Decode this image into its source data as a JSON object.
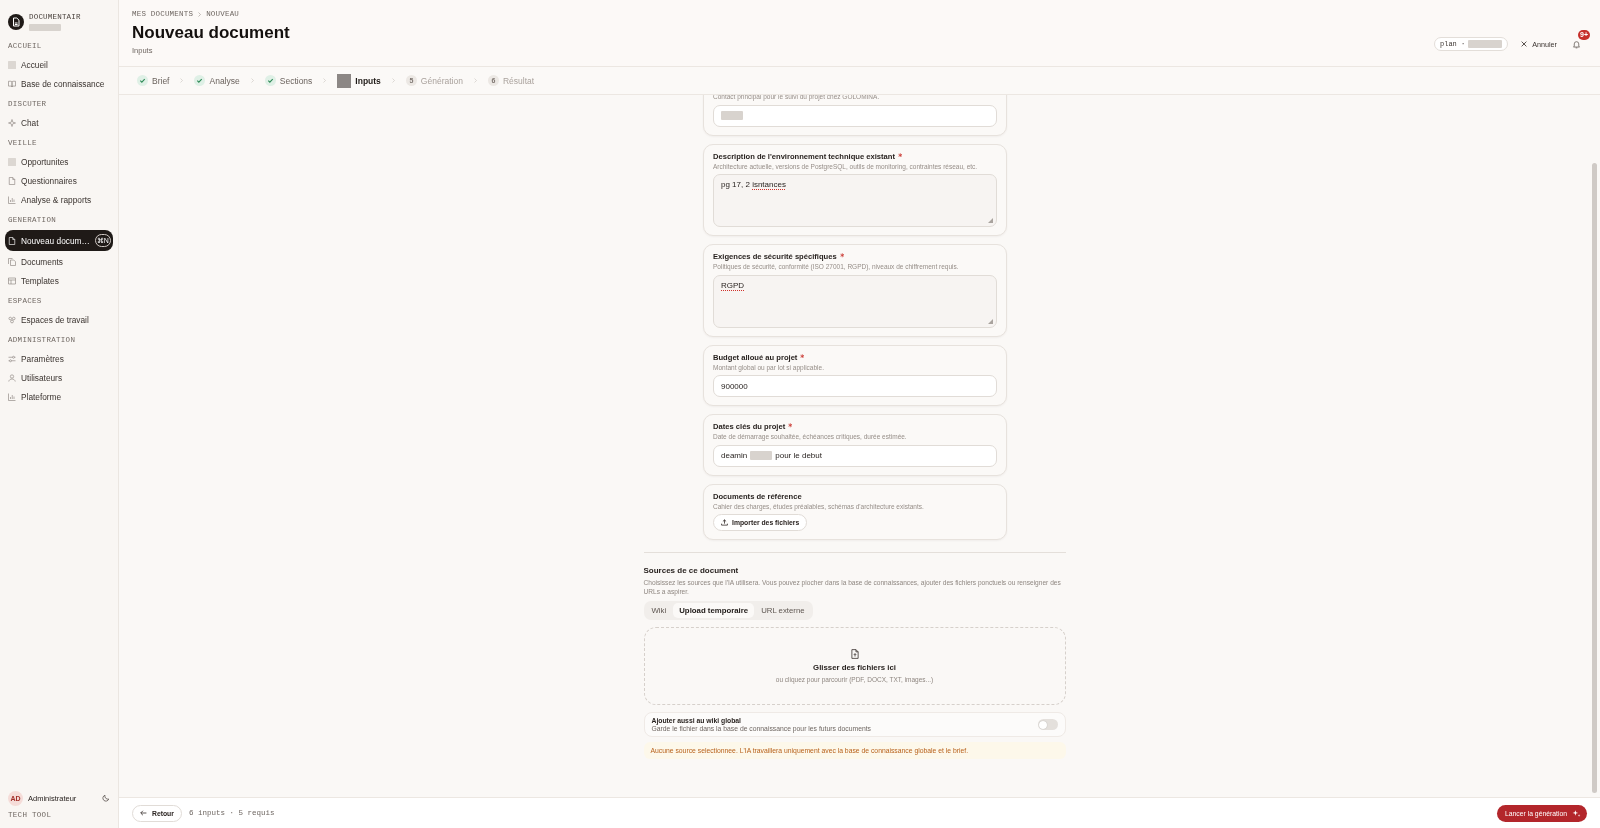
{
  "sidebar": {
    "brand": "DOCUMENTAIR",
    "sections": [
      {
        "label": "ACCUEIL",
        "items": [
          {
            "label": "Accueil",
            "selected": false
          },
          {
            "label": "Base de connaissance",
            "selected": false
          }
        ]
      },
      {
        "label": "DISCUTER",
        "items": [
          {
            "label": "Chat",
            "selected": false
          }
        ]
      },
      {
        "label": "VEILLE",
        "items": [
          {
            "label": "Opportunites",
            "selected": false
          },
          {
            "label": "Questionnaires",
            "selected": false
          },
          {
            "label": "Analyse & rapports",
            "selected": false
          }
        ]
      },
      {
        "label": "GENERATION",
        "items": [
          {
            "label": "Nouveau docum…",
            "selected": true,
            "shortcut": "⌘N"
          },
          {
            "label": "Documents",
            "selected": false
          },
          {
            "label": "Templates",
            "selected": false
          }
        ]
      },
      {
        "label": "ESPACES",
        "items": [
          {
            "label": "Espaces de travail",
            "selected": false
          }
        ]
      },
      {
        "label": "ADMINISTRATION",
        "items": [
          {
            "label": "Paramètres",
            "selected": false
          },
          {
            "label": "Utilisateurs",
            "selected": false
          },
          {
            "label": "Plateforme",
            "selected": false
          }
        ]
      }
    ],
    "user": {
      "initials": "AD",
      "name": "Administrateur"
    },
    "footer": "TECH TOOL"
  },
  "header": {
    "breadcrumb": [
      "MES DOCUMENTS",
      "NOUVEAU"
    ],
    "title": "Nouveau document",
    "subtitle": "Inputs",
    "plan_label": "plan ·",
    "cancel": "Annuler",
    "notifications": "9+"
  },
  "stepper": {
    "steps": [
      {
        "label": "Brief",
        "kind": "done"
      },
      {
        "label": "Analyse",
        "kind": "done"
      },
      {
        "label": "Sections",
        "kind": "done"
      },
      {
        "label": "Inputs",
        "kind": "current"
      },
      {
        "label": "Génération",
        "kind": "pending",
        "number": "5"
      },
      {
        "label": "Résultat",
        "kind": "pending",
        "number": "6"
      }
    ]
  },
  "form": {
    "fields": [
      {
        "kind": "input",
        "hint": "Contact principal pour le suivi du projet chez GOLOMINA.",
        "value": [
          {
            "kind": "redacted"
          }
        ]
      },
      {
        "kind": "textarea",
        "label": "Description de l'environnement technique existant",
        "required": true,
        "hint": "Architecture actuelle, versions de PostgreSQL, outils de monitoring, contraintes réseau, etc.",
        "value": [
          {
            "kind": "text",
            "text": "pg 17, 2 "
          },
          {
            "kind": "text",
            "text": "isntances",
            "misspelled": true
          }
        ]
      },
      {
        "kind": "textarea",
        "label": "Exigences de sécurité spécifiques",
        "required": true,
        "hint": "Politiques de sécurité, conformité (ISO 27001, RGPD), niveaux de chiffrement requis.",
        "value": [
          {
            "kind": "text",
            "text": "RGPD",
            "misspelled": true
          }
        ]
      },
      {
        "kind": "input",
        "label": "Budget alloué au projet",
        "required": true,
        "hint": "Montant global ou par lot si applicable.",
        "value": [
          {
            "kind": "text",
            "text": "900000"
          }
        ]
      },
      {
        "kind": "input",
        "label": "Dates clés du projet",
        "required": true,
        "hint": "Date de démarrage souhaitée, échéances critiques, durée estimée.",
        "value": [
          {
            "kind": "text",
            "text": "deamin"
          },
          {
            "kind": "redacted"
          },
          {
            "kind": "text",
            "text": "pour le debut"
          }
        ]
      },
      {
        "kind": "upload",
        "label": "Documents de référence",
        "required": false,
        "hint": "Cahier des charges, études préalables, schémas d'architecture existants.",
        "button": "Importer des fichiers"
      }
    ]
  },
  "sources": {
    "title": "Sources de ce document",
    "description": "Choisissez les sources que l'IA utilisera. Vous pouvez piocher dans la base de connaissances, ajouter des fichiers ponctuels ou renseigner des URLs a aspirer.",
    "tabs": [
      {
        "label": "Wiki",
        "selected": false
      },
      {
        "label": "Upload temporaire",
        "selected": true
      },
      {
        "label": "URL externe",
        "selected": false
      }
    ],
    "dropzone": {
      "title": "Glisser des fichiers ici",
      "hint": "ou cliquez pour parcourir (PDF, DOCX, TXT, images...)"
    },
    "toggle": {
      "label": "Ajouter aussi au wiki global",
      "description": "Garde le fichier dans la base de connaissance pour les futurs documents",
      "on": false
    },
    "warning": "Aucune source selectionnee. L'IA travaillera uniquement avec la base de connaissance globale et le brief."
  },
  "footer": {
    "back": "Retour",
    "summary": "6 inputs · 5 requis",
    "submit": "Lancer la génération"
  }
}
